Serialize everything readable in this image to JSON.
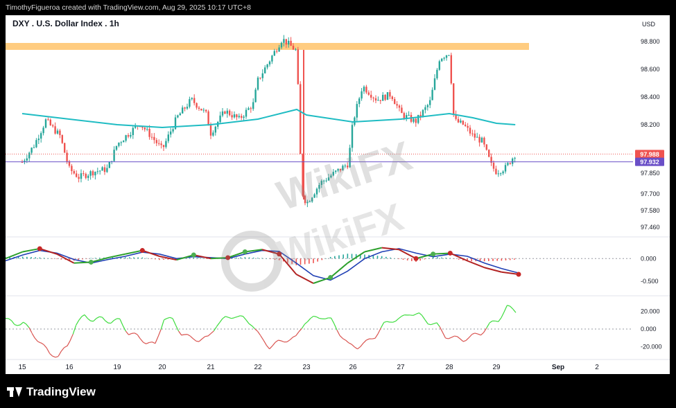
{
  "header": {
    "attribution": "TimothyFigueroa created with TradingView.com, Aug 29, 2025 10:17 UTC+8"
  },
  "footer": {
    "brand": "TradingView",
    "brand_icon": "tradingview-logo-icon"
  },
  "watermark": {
    "text": "WikiFX"
  },
  "colors": {
    "up": "#26a69a",
    "down": "#ef5350",
    "ma": "#1fbcc3",
    "resistance": "#ffcc80",
    "macd_fast": "#2ca02c",
    "macd_signal": "#1f3fb4",
    "osc_up": "#3ddc3d",
    "osc_down": "#d9534f",
    "last_price": "#ef5350",
    "ref_price": "#6a4fc7"
  },
  "chart_data": [
    {
      "type": "candlestick",
      "title": "DXY . U.S. Dollar Index . 1h",
      "currency": "USD",
      "x_tick_labels": [
        "15",
        "16",
        "19",
        "20",
        "21",
        "22",
        "23",
        "26",
        "27",
        "28",
        "29",
        "Sep",
        "2"
      ],
      "y_tick_labels": [
        "98.800",
        "98.600",
        "98.400",
        "98.200",
        "97.850",
        "97.700",
        "97.580",
        "97.460"
      ],
      "ylim": [
        97.4,
        98.85
      ],
      "price_labels": {
        "last": "97.988",
        "ref": "97.932"
      },
      "resistance_zone": [
        98.74,
        98.79
      ],
      "close_path": [
        {
          "d": "15",
          "v": 97.93
        },
        {
          "d": "15.25",
          "v": 98.05
        },
        {
          "d": "15.5",
          "v": 98.23
        },
        {
          "d": "15.8",
          "v": 98.12
        },
        {
          "d": "16",
          "v": 97.88
        },
        {
          "d": "16.2",
          "v": 97.82
        },
        {
          "d": "16.5",
          "v": 97.86
        },
        {
          "d": "16.8",
          "v": 97.88
        },
        {
          "d": "19",
          "v": 98.06
        },
        {
          "d": "19.5",
          "v": 98.21
        },
        {
          "d": "19.8",
          "v": 98.1
        },
        {
          "d": "20",
          "v": 98.02
        },
        {
          "d": "20.3",
          "v": 98.25
        },
        {
          "d": "20.6",
          "v": 98.38
        },
        {
          "d": "20.9",
          "v": 98.28
        },
        {
          "d": "21",
          "v": 98.14
        },
        {
          "d": "21.3",
          "v": 98.3
        },
        {
          "d": "21.6",
          "v": 98.24
        },
        {
          "d": "21.9",
          "v": 98.35
        },
        {
          "d": "22",
          "v": 98.52
        },
        {
          "d": "22.3",
          "v": 98.7
        },
        {
          "d": "22.5",
          "v": 98.82
        },
        {
          "d": "22.8",
          "v": 98.73
        },
        {
          "d": "22.9",
          "v": 97.72
        },
        {
          "d": "23",
          "v": 97.63
        },
        {
          "d": "23.3",
          "v": 97.78
        },
        {
          "d": "23.6",
          "v": 97.85
        },
        {
          "d": "23.9",
          "v": 97.92
        },
        {
          "d": "26",
          "v": 98.22
        },
        {
          "d": "26.2",
          "v": 98.48
        },
        {
          "d": "26.5",
          "v": 98.38
        },
        {
          "d": "26.8",
          "v": 98.42
        },
        {
          "d": "27",
          "v": 98.28
        },
        {
          "d": "27.3",
          "v": 98.22
        },
        {
          "d": "27.6",
          "v": 98.36
        },
        {
          "d": "27.8",
          "v": 98.68
        },
        {
          "d": "28",
          "v": 98.72
        },
        {
          "d": "28.1",
          "v": 98.23
        },
        {
          "d": "28.3",
          "v": 98.2
        },
        {
          "d": "28.5",
          "v": 98.12
        },
        {
          "d": "28.7",
          "v": 98.08
        },
        {
          "d": "28.9",
          "v": 97.9
        },
        {
          "d": "29",
          "v": 97.86
        },
        {
          "d": "29.2",
          "v": 97.89
        },
        {
          "d": "29.4",
          "v": 97.99
        }
      ],
      "moving_average": [
        {
          "d": "15",
          "v": 98.28
        },
        {
          "d": "16",
          "v": 98.24
        },
        {
          "d": "19",
          "v": 98.2
        },
        {
          "d": "20",
          "v": 98.18
        },
        {
          "d": "21",
          "v": 98.2
        },
        {
          "d": "22",
          "v": 98.24
        },
        {
          "d": "22.8",
          "v": 98.31
        },
        {
          "d": "23",
          "v": 98.27
        },
        {
          "d": "26",
          "v": 98.22
        },
        {
          "d": "27",
          "v": 98.24
        },
        {
          "d": "28",
          "v": 98.28
        },
        {
          "d": "28.5",
          "v": 98.25
        },
        {
          "d": "29",
          "v": 98.21
        },
        {
          "d": "29.4",
          "v": 98.2
        }
      ]
    },
    {
      "type": "line",
      "name": "macd",
      "y_tick_labels": [
        "0.000",
        "-0.500"
      ],
      "ylim": [
        -0.75,
        0.45
      ],
      "fast": [
        0.0,
        0.15,
        0.22,
        0.1,
        -0.1,
        -0.08,
        0.02,
        0.1,
        0.18,
        0.05,
        -0.03,
        0.08,
        0.0,
        0.02,
        0.15,
        0.2,
        0.1,
        -0.35,
        -0.55,
        -0.42,
        -0.1,
        0.15,
        0.24,
        0.2,
        0.0,
        0.1,
        0.12,
        -0.05,
        -0.2,
        -0.3,
        -0.35
      ],
      "signal": [
        -0.05,
        0.08,
        0.18,
        0.12,
        -0.02,
        -0.1,
        -0.02,
        0.05,
        0.14,
        0.1,
        0.0,
        0.04,
        0.02,
        0.0,
        0.1,
        0.18,
        0.16,
        -0.1,
        -0.38,
        -0.48,
        -0.28,
        0.0,
        0.15,
        0.22,
        0.12,
        0.04,
        0.1,
        0.05,
        -0.1,
        -0.22,
        -0.32
      ],
      "markers": [
        {
          "i": 2,
          "kind": "cross-down"
        },
        {
          "i": 5,
          "kind": "cross-up"
        },
        {
          "i": 8,
          "kind": "cross-down"
        },
        {
          "i": 11,
          "kind": "cross-up"
        },
        {
          "i": 13,
          "kind": "cross-down"
        },
        {
          "i": 14,
          "kind": "cross-up"
        },
        {
          "i": 16,
          "kind": "cross-down"
        },
        {
          "i": 19,
          "kind": "cross-up"
        },
        {
          "i": 24,
          "kind": "cross-down"
        },
        {
          "i": 25,
          "kind": "cross-up"
        },
        {
          "i": 26,
          "kind": "cross-down"
        },
        {
          "i": 30,
          "kind": "cross-down"
        }
      ]
    },
    {
      "type": "line",
      "name": "oscillator",
      "y_tick_labels": [
        "20.000",
        "0.000",
        "-20.000"
      ],
      "ylim": [
        -32,
        32
      ],
      "values": [
        12,
        5,
        8,
        -5,
        -15,
        -28,
        -30,
        -20,
        5,
        15,
        10,
        12,
        8,
        10,
        -5,
        -8,
        -15,
        -18,
        12,
        10,
        -5,
        -10,
        -12,
        -10,
        5,
        12,
        15,
        12,
        6,
        -10,
        -20,
        -15,
        -12,
        -10,
        8,
        12,
        14,
        10,
        -5,
        -18,
        -20,
        -15,
        -8,
        5,
        10,
        12,
        18,
        16,
        8,
        5,
        -8,
        -10,
        -12,
        -8,
        -5,
        5,
        10,
        25,
        20
      ],
      "threshold": 0
    }
  ]
}
